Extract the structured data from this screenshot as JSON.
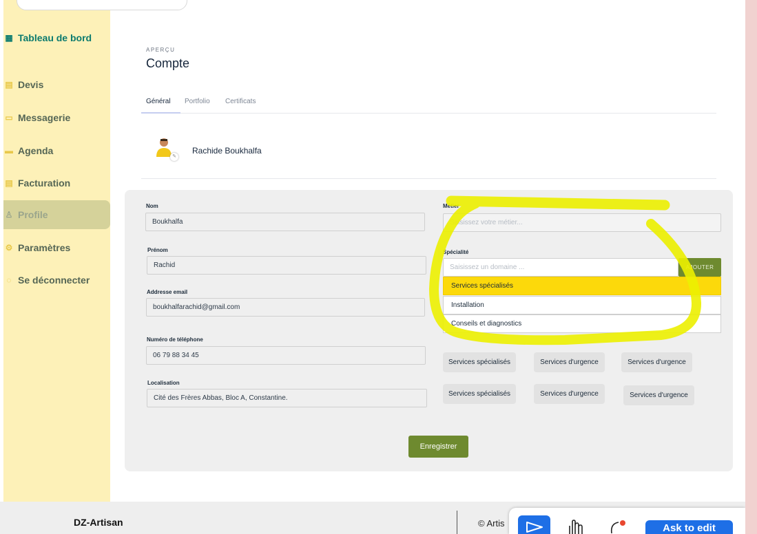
{
  "sidebar": {
    "items": [
      {
        "label": "Tableau de bord"
      },
      {
        "label": "Devis"
      },
      {
        "label": "Messagerie"
      },
      {
        "label": "Agenda"
      },
      {
        "label": "Facturation"
      },
      {
        "label": "Profile"
      },
      {
        "label": "Paramètres"
      },
      {
        "label": "Se déconnecter"
      }
    ]
  },
  "header": {
    "overline": "APERÇU",
    "title": "Compte"
  },
  "tabs": [
    {
      "label": "Général",
      "active": true
    },
    {
      "label": "Portfolio"
    },
    {
      "label": "Certificats"
    }
  ],
  "profile": {
    "name": "Rachide Boukhalfa"
  },
  "form": {
    "nom": {
      "label": "Nom",
      "value": "Boukhalfa"
    },
    "prenom": {
      "label": "Prénom",
      "value": "Rachid"
    },
    "email": {
      "label": "Addresse email",
      "value": "boukhalfarachid@gmail.com"
    },
    "phone": {
      "label": "Numéro de téléphone",
      "value": "06 79 88 34 45"
    },
    "location": {
      "label": "Localisation",
      "value": "Cité des Frères Abbas, Bloc A, Constantine."
    },
    "metier": {
      "label": "Métier",
      "placeholder": "Saisissez votre métier..."
    },
    "specialite": {
      "label": "Spécialité",
      "placeholder": "Saisissez un domaine ...",
      "add_label": "AJOUTER"
    },
    "dropdown_options": [
      "Services spécialisés",
      "Installation",
      "Conseils et diagnostics"
    ],
    "chips": [
      "Services spécialisés",
      "Services d'urgence",
      "Services d'urgence",
      "Services spécialisés",
      "Services d'urgence",
      "Services d'urgence"
    ],
    "save_label": "Enregistrer"
  },
  "footer": {
    "brand": "DZ-Artisan",
    "copyright": "© Artis"
  },
  "toolbar": {
    "ask_label": "Ask to edit"
  },
  "colors": {
    "sidebar_bg": "#fdf1b8",
    "accent_green": "#6e8a2f",
    "highlight_yellow": "#fcd90b",
    "toolbar_blue": "#1e6fe6"
  }
}
